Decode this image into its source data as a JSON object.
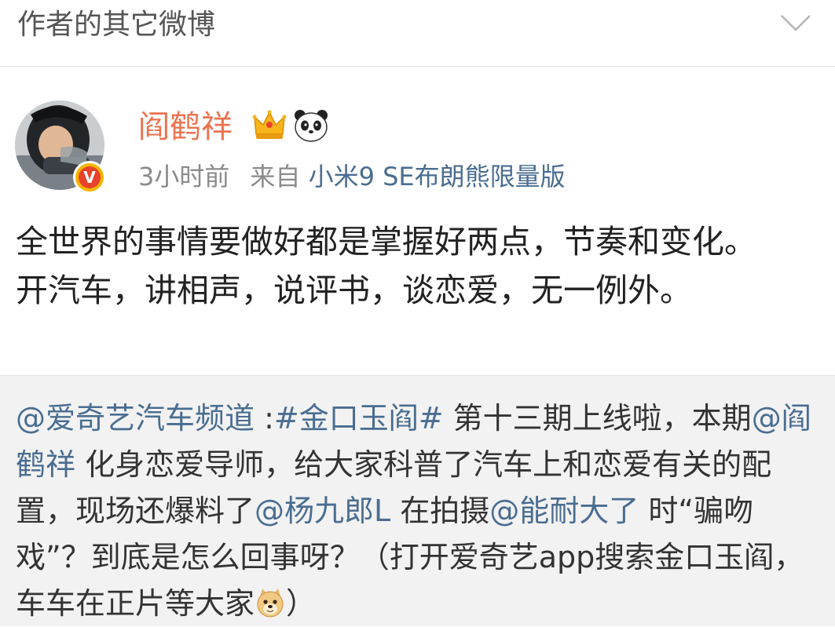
{
  "header": {
    "title": "作者的其它微博"
  },
  "post": {
    "username": "阎鹤祥",
    "time": "3小时前",
    "source_prefix": "来自",
    "source_device": "小米9 SE布朗熊限量版",
    "verified_badge": "V",
    "text": "全世界的事情要做好都是掌握好两点，节奏和变化。开汽车，讲相声，说评书，谈恋爱，无一例外。"
  },
  "repost": {
    "mention_channel": "@爱奇艺汽车频道",
    "colon": " :",
    "topic": "#金口玉阎#",
    "text_1": " 第十三期上线啦，本期",
    "mention_author": "@阎鹤祥",
    "text_2": " 化身恋爱导师，给大家科普了汽车上和恋爱有关的配置，现场还爆料了",
    "mention_yang": "@杨九郎L",
    "text_3": " 在拍摄",
    "mention_nengnai": "@能耐大了",
    "text_4": " 时“骗吻戏”？到底是怎么回事呀？（打开爱奇艺app搜索金口玉阎，车车在正片等大家",
    "text_5": "）"
  },
  "colors": {
    "username": "#eb7350",
    "link": "#4a6d91",
    "meta": "#8a8a8a",
    "repost_bg": "#f2f2f2"
  },
  "icons": {
    "collapse": "chevron-down-icon",
    "crown": "crown-icon",
    "panda": "panda-icon",
    "verified": "verified-badge-icon",
    "doge": "doge-emoji-icon"
  }
}
